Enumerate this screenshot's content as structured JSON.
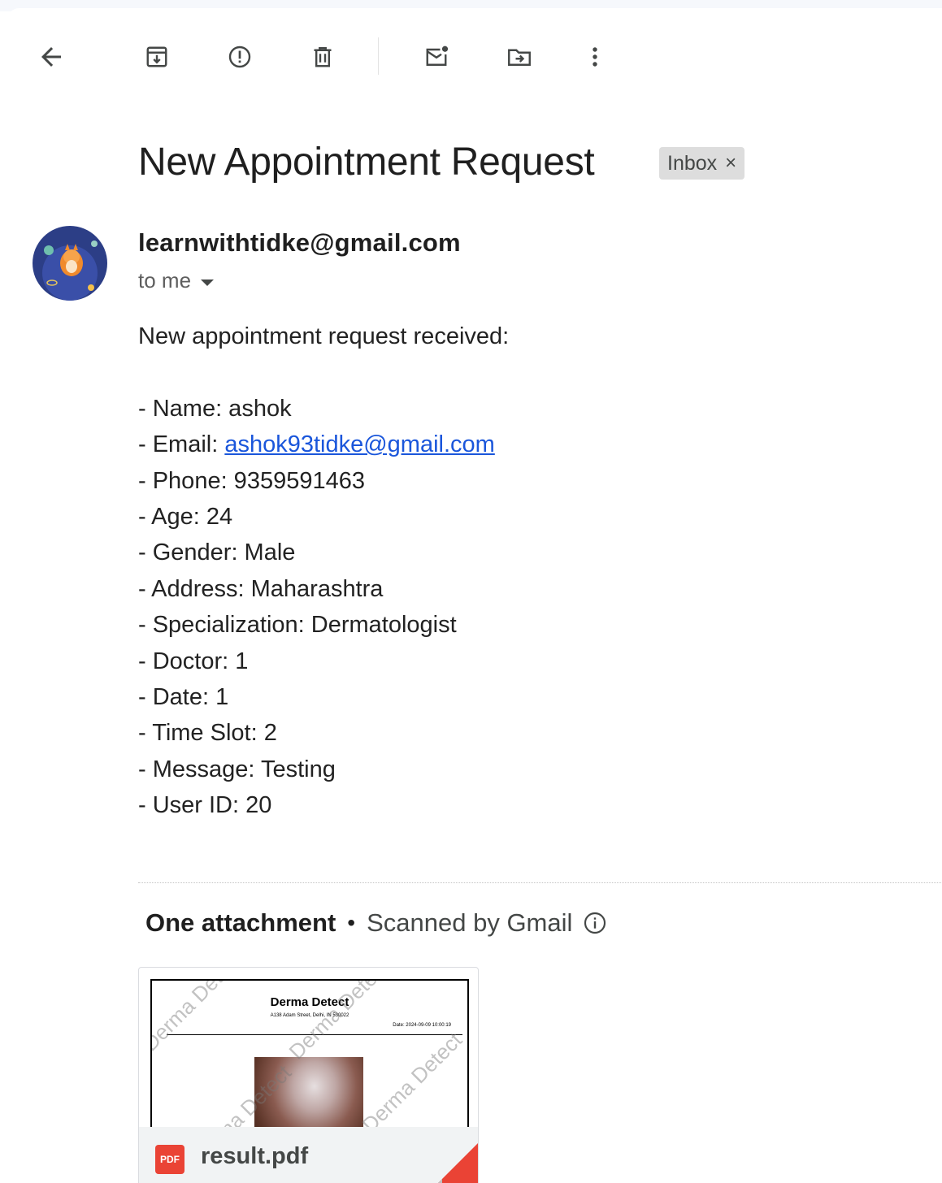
{
  "toolbar": {
    "back": "back-arrow-icon",
    "archive": "archive-icon",
    "report_spam": "report-spam-icon",
    "delete": "trash-icon",
    "mark_unread": "mark-unread-icon",
    "move_to": "move-to-folder-icon",
    "more": "more-vert-icon"
  },
  "message": {
    "subject": "New Appointment Request",
    "label": "Inbox",
    "label_remove": "×",
    "sender_email": "learnwithtidke@gmail.com",
    "recipient": "to me",
    "intro": "New appointment request received:",
    "fields": {
      "name": "- Name: ashok",
      "email_prefix": "- Email: ",
      "email_link": "ashok93tidke@gmail.com",
      "phone": "- Phone: 9359591463",
      "age": "- Age: 24",
      "gender": "- Gender: Male",
      "address": "- Address: Maharashtra",
      "specialization": "- Specialization: Dermatologist",
      "doctor": "- Doctor: 1",
      "date": "- Date: 1",
      "time_slot": "- Time Slot: 2",
      "message": "- Message: Testing",
      "user_id": "- User ID: 20"
    }
  },
  "attachments": {
    "count_label": "One attachment",
    "separator": "•",
    "scan_label": "Scanned by Gmail",
    "file": {
      "name": "result.pdf",
      "type_badge": "PDF",
      "preview_title": "Derma Detect",
      "preview_address": "A138 Adam Street, Delhi, IN 530022",
      "preview_date": "Date: 2024-09-09 10:00:19",
      "watermark": "Derma Detect"
    }
  },
  "colors": {
    "link": "#1a56db",
    "pdf_red": "#ea4335",
    "chip_bg": "#dddddd"
  }
}
